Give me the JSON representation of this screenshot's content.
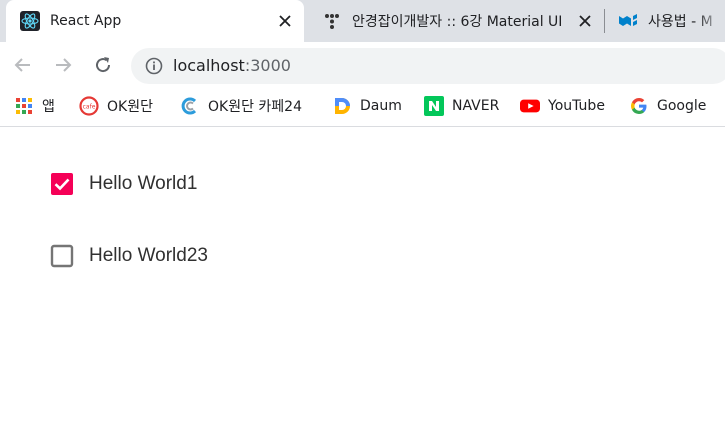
{
  "browser": {
    "tabs": [
      {
        "title": "React App",
        "icon": "react-icon",
        "active": true
      },
      {
        "title": "안경잡이개발자 :: 6강 Material UI",
        "icon": "tistory-icon",
        "active": false
      },
      {
        "title": "사용법 - M",
        "icon": "mui-icon",
        "active": false
      }
    ],
    "url_host": "localhost",
    "url_port": ":3000"
  },
  "bookmarks": [
    {
      "label": "앱",
      "icon": "apps-grid-icon"
    },
    {
      "label": "OK원단",
      "icon": "cafe-icon"
    },
    {
      "label": "OK원단 카페24",
      "icon": "cafe24-icon"
    },
    {
      "label": "Daum",
      "icon": "daum-icon"
    },
    {
      "label": "NAVER",
      "icon": "naver-icon"
    },
    {
      "label": "YouTube",
      "icon": "youtube-icon"
    },
    {
      "label": "Google",
      "icon": "google-icon"
    }
  ],
  "page": {
    "checkboxes": [
      {
        "label": "Hello World1",
        "checked": true
      },
      {
        "label": "Hello World23",
        "checked": false
      }
    ]
  },
  "colors": {
    "checkbox_checked": "#f50057",
    "checkbox_unchecked": "#757575"
  }
}
